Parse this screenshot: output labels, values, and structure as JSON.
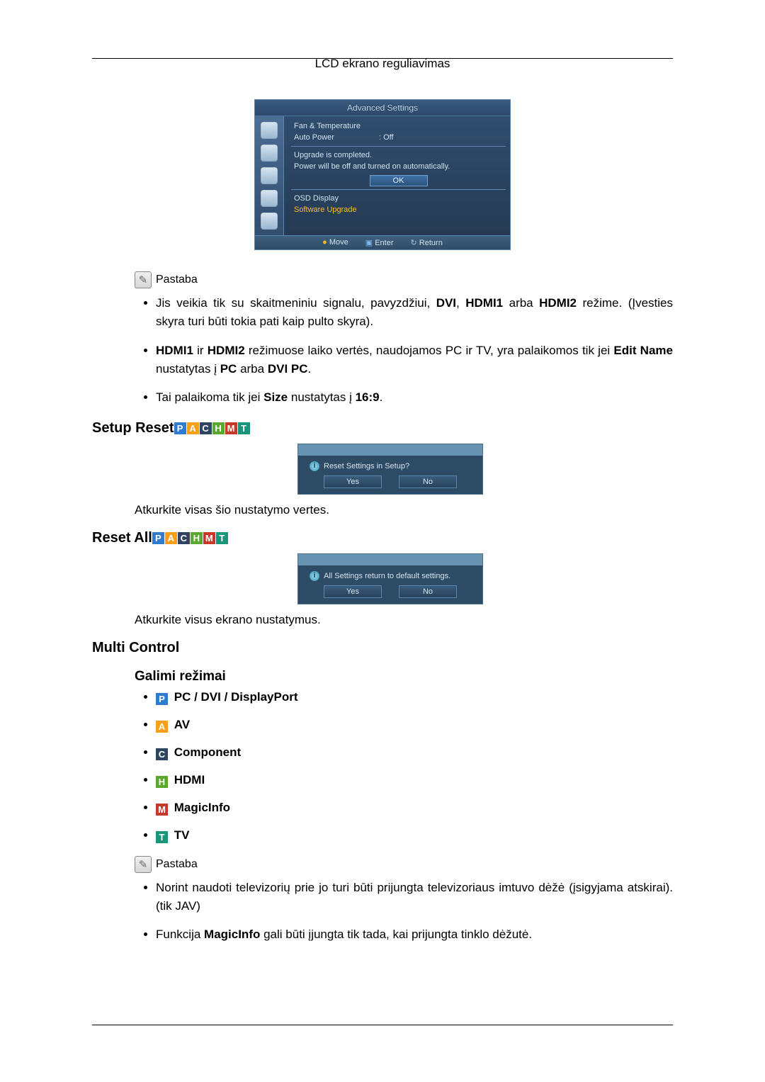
{
  "page": {
    "title": "LCD ekrano reguliavimas"
  },
  "osd1": {
    "title": "Advanced Settings",
    "fan": "Fan & Temperature",
    "autoPowerKey": "Auto Power",
    "autoPowerVal": ": Off",
    "msg1": "Upgrade is completed.",
    "msg2": "Power will be off and turned on automatically.",
    "ok": "OK",
    "osdDisplay": "OSD Display",
    "swUpgrade": "Software Upgrade",
    "footer": {
      "move": "Move",
      "enter": "Enter",
      "return": "Return"
    }
  },
  "note1Label": "Pastaba",
  "bullets1": [
    {
      "pre": "Jis veikia tik su skaitmeniniu signalu, pavyzdžiui, ",
      "b1": "DVI",
      "mid1": ", ",
      "b2": "HDMI1",
      "mid2": " arba ",
      "b3": "HDMI2",
      "post": " režime. (Įves­ties skyra turi būti tokia pati kaip pulto skyra)."
    },
    {
      "b1": "HDMI1",
      "mid1": " ir ",
      "b2": "HDMI2",
      "post1": " režimuose laiko vertės, naudojamos PC ir TV, yra palaikomos tik jei ",
      "b3": "Edit Name",
      "mid3": " nustatytas į ",
      "b4": "PC",
      "mid4": " arba ",
      "b5": "DVI PC",
      "end": "."
    },
    {
      "pre": "Tai palaikoma tik jei ",
      "b1": "Size",
      "mid1": " nustatytas į ",
      "b2": "16:9",
      "end": "."
    }
  ],
  "setupReset": {
    "heading": "Setup Reset",
    "question": "Reset Settings in Setup?",
    "yes": "Yes",
    "no": "No",
    "desc": "Atkurkite visas šio nustatymo vertes."
  },
  "resetAll": {
    "heading": "Reset All",
    "question": "All Settings return to default settings.",
    "yes": "Yes",
    "no": "No",
    "desc": "Atkurkite visus ekrano nustatymus."
  },
  "multiControl": {
    "heading": "Multi Control",
    "subHeading": "Galimi režimai"
  },
  "modes": {
    "P": "PC / DVI / DisplayPort",
    "A": "AV",
    "C": "Component",
    "H": "HDMI",
    "M": "MagicInfo",
    "T": "TV"
  },
  "note2Label": "Pastaba",
  "bullets2": [
    "Norint naudoti televizorių prie jo turi būti prijungta televizoriaus imtuvo dėžė (įsigyjama atskirai). (tik JAV)",
    {
      "pre": "Funkcija ",
      "b1": "MagicInfo",
      "post": " gali būti įjungta tik tada, kai prijungta tinklo dėžutė."
    }
  ]
}
